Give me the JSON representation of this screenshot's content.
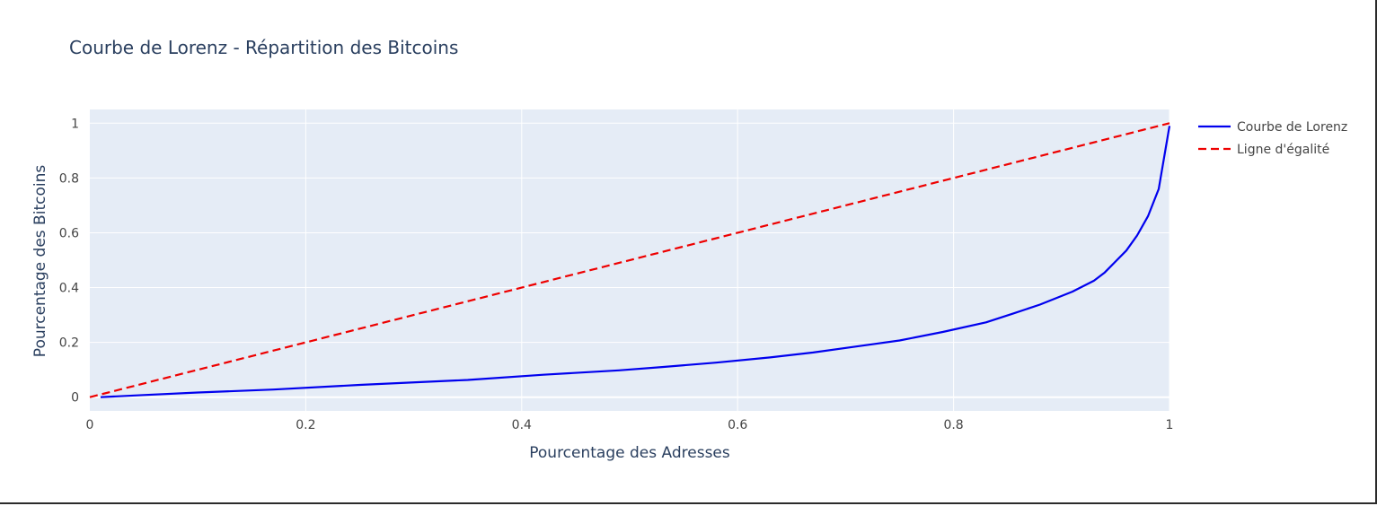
{
  "chart_data": {
    "type": "line",
    "title": "Courbe de Lorenz - Répartition des Bitcoins",
    "xlabel": "Pourcentage des Adresses",
    "ylabel": "Pourcentage des Bitcoins",
    "xlim": [
      0,
      1
    ],
    "ylim": [
      -0.05,
      1.05
    ],
    "x_ticks": [
      0,
      0.2,
      0.4,
      0.6,
      0.8,
      1
    ],
    "x_tick_labels": [
      "0",
      "0.2",
      "0.4",
      "0.6",
      "0.8",
      "1"
    ],
    "y_ticks": [
      0,
      0.2,
      0.4,
      0.6,
      0.8,
      1
    ],
    "y_tick_labels": [
      "0",
      "0.2",
      "0.4",
      "0.6",
      "0.8",
      "1"
    ],
    "grid": true,
    "legend_position": "right",
    "plot_background": "#e5ecf6",
    "series": [
      {
        "name": "Courbe de Lorenz",
        "color": "#0000ee",
        "dash": "solid",
        "x": [
          0.01,
          0.05,
          0.1,
          0.17,
          0.25,
          0.35,
          0.42,
          0.49,
          0.53,
          0.58,
          0.63,
          0.67,
          0.71,
          0.75,
          0.79,
          0.83,
          0.855,
          0.88,
          0.91,
          0.93,
          0.94,
          0.95,
          0.96,
          0.97,
          0.98,
          0.99,
          1.0
        ],
        "y": [
          0.0,
          0.008,
          0.017,
          0.028,
          0.045,
          0.063,
          0.082,
          0.098,
          0.11,
          0.126,
          0.145,
          0.163,
          0.185,
          0.207,
          0.238,
          0.273,
          0.305,
          0.338,
          0.385,
          0.425,
          0.455,
          0.495,
          0.535,
          0.59,
          0.66,
          0.76,
          0.99
        ]
      },
      {
        "name": "Ligne d'égalité",
        "color": "#ee0000",
        "dash": "dashed",
        "x": [
          0,
          1
        ],
        "y": [
          0,
          1
        ]
      }
    ]
  }
}
